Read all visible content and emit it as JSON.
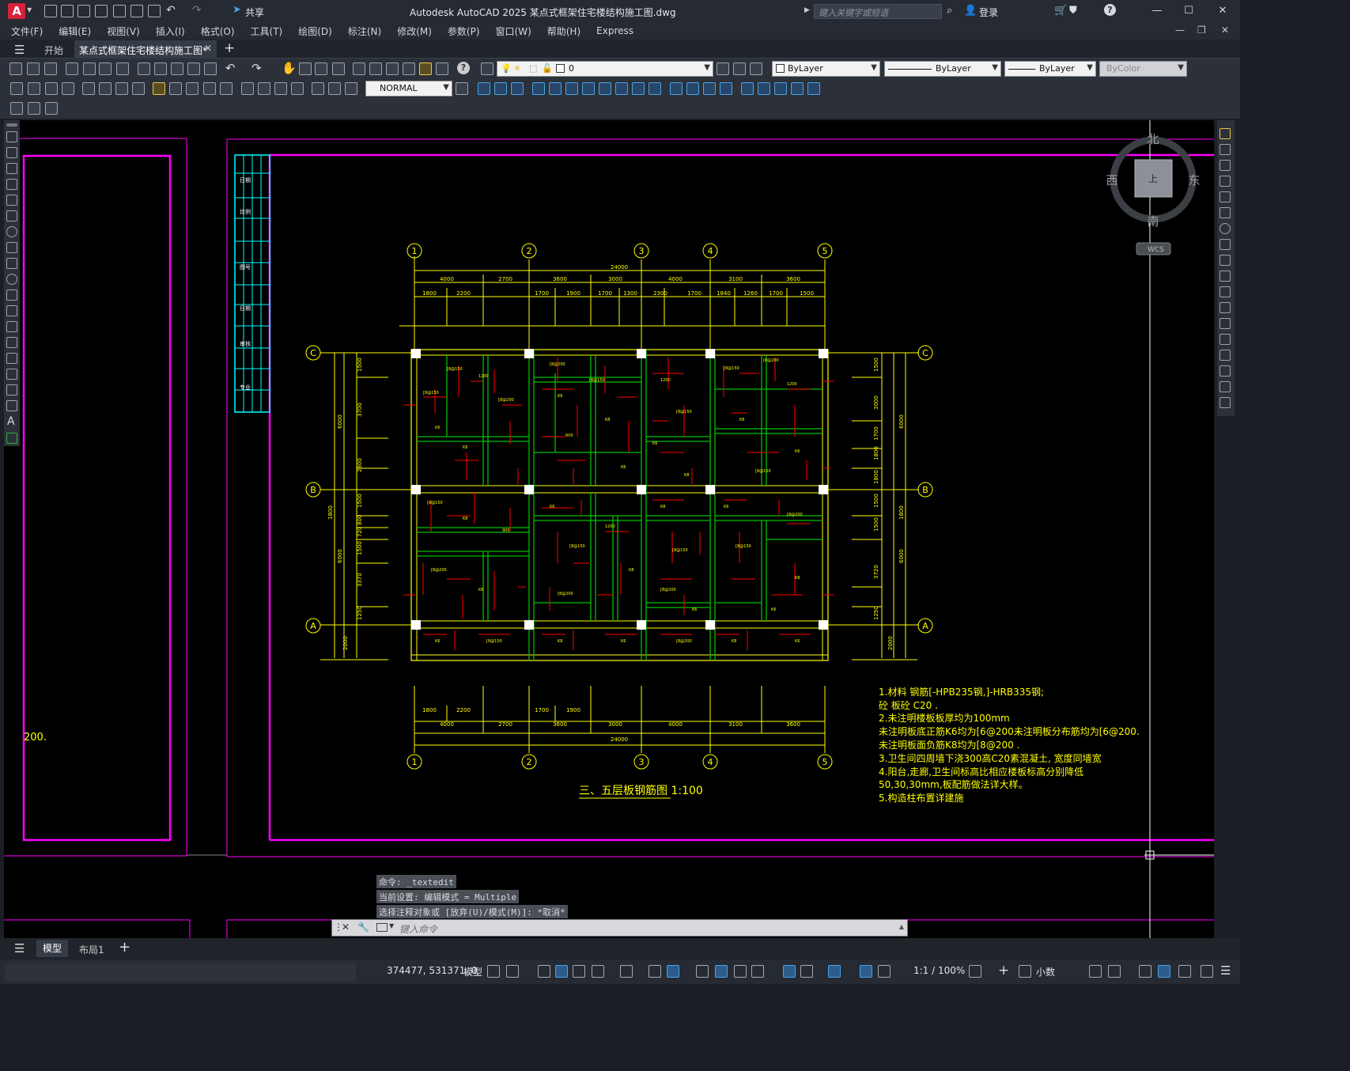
{
  "app": {
    "logo": "A",
    "title": "Autodesk AutoCAD 2025    某点式框架住宅楼结构施工图.dwg",
    "share": "共享",
    "search_placeholder": "键入关键字或短语",
    "login": "登录"
  },
  "window": {
    "min": "—",
    "max": "☐",
    "close": "✕"
  },
  "menus": [
    "文件(F)",
    "编辑(E)",
    "视图(V)",
    "插入(I)",
    "格式(O)",
    "工具(T)",
    "绘图(D)",
    "标注(N)",
    "修改(M)",
    "参数(P)",
    "窗口(W)",
    "帮助(H)",
    "Express"
  ],
  "tabs": {
    "start": "开始",
    "file": "某点式框架住宅楼结构施工图*",
    "add": "+"
  },
  "toolbar": {
    "layer_value": "0",
    "color": "ByLayer",
    "linetype": "ByLayer",
    "lineweight": "ByLayer",
    "plotstyle": "ByColor",
    "dimstyle": "NORMAL"
  },
  "viewcube": {
    "north": "北",
    "south": "南",
    "east": "东",
    "west": "西",
    "face": "上",
    "wcs": "WCS"
  },
  "drawing": {
    "axes_top": [
      "1",
      "2",
      "3",
      "4",
      "5"
    ],
    "axes_side": [
      "C",
      "B",
      "A"
    ],
    "total_dim": "24000",
    "top_dims": [
      "4000",
      "2700",
      "3600",
      "3000",
      "4000",
      "3100",
      "3600"
    ],
    "top_sub": [
      "1800",
      "2200",
      "1700",
      "1900",
      "1700",
      "1300",
      "2300",
      "1700",
      "1840",
      "1260",
      "1700",
      "1500"
    ],
    "bottom_sub": [
      "1800",
      "2200",
      "1700",
      "1900"
    ],
    "left_dims": [
      "6000",
      "1800",
      "6000"
    ],
    "left_sub": [
      "1500",
      "3700",
      "2300",
      "1500",
      "800",
      "720",
      "1500",
      "3370",
      "1250",
      "2000"
    ],
    "right_sub": [
      "1500",
      "3000",
      "1700",
      "1800",
      "1800",
      "1500",
      "1500",
      "3720",
      "1250",
      "2000"
    ],
    "left_frag": "200.",
    "title": "三、五层板钢筋图 1:100",
    "notes": [
      "1.材料 钢筋[-HPB235钢,]-HRB335钢;",
      "   砼 板砼 C20 .",
      "2.未注明楼板板厚均为100mm",
      "   未注明板底正筋K6均为[6@200未注明板分布筋均为[6@200.",
      "   未注明板面负筋K8均为[8@200 .",
      "3.卫生间四周墙下浇300高C20素混凝土, 宽度同墙宽",
      "4.阳台,走廊,卫生间标高比相应楼板标高分别降低",
      "   50,30,30mm,板配筋做法详大样。",
      "5.构造柱布置详建施"
    ],
    "stamp": [
      "日期",
      "比例",
      "图号",
      "日期",
      "审核",
      "专业"
    ]
  },
  "command": {
    "line1": "命令: _textedit",
    "line2": "当前设置: 编辑模式 = Multiple",
    "line3": "选择注释对象或 [放弃(U)/模式(M)]: *取消*",
    "placeholder": "键入命令"
  },
  "layout": {
    "model": "模型",
    "layout1": "布局1",
    "add": "+"
  },
  "status": {
    "coords": "374477, 531371, 0",
    "model": "模型",
    "scale": "1:1 / 100%",
    "units": "小数"
  },
  "colors": {
    "magenta": "#ff00ff",
    "yellow": "#ffff00",
    "green": "#00c000",
    "red": "#ff0000",
    "cyan": "#00ffff"
  }
}
